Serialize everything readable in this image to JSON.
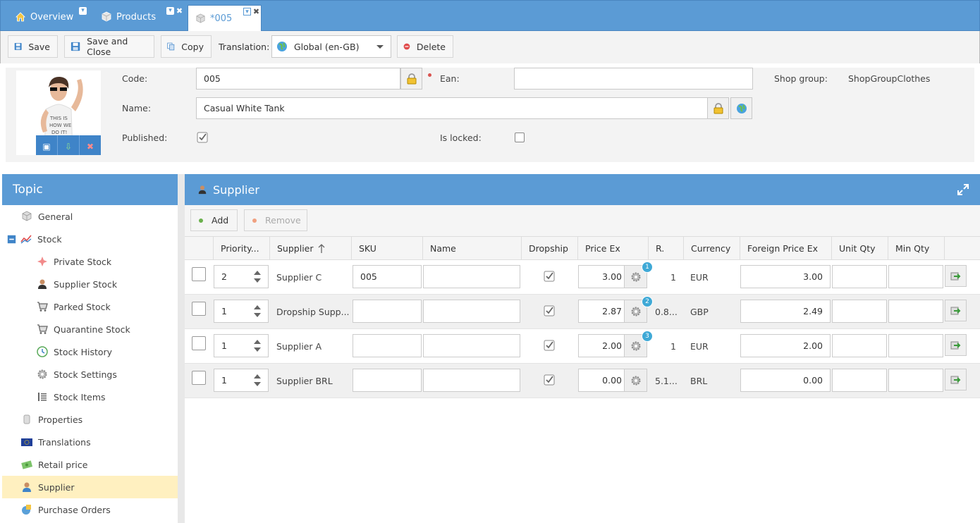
{
  "tabs": {
    "overview": "Overview",
    "products": "Products",
    "active": "*005"
  },
  "toolbar": {
    "save": "Save",
    "save_close": "Save and Close",
    "copy": "Copy",
    "translation_label": "Translation:",
    "translation_value": "Global (en-GB)",
    "delete": "Delete"
  },
  "form": {
    "code_label": "Code:",
    "code_value": "005",
    "ean_label": "Ean:",
    "ean_value": "",
    "shop_group_label": "Shop group:",
    "shop_group_value": "ShopGroupClothes",
    "name_label": "Name:",
    "name_value": "Casual White Tank",
    "published_label": "Published:",
    "published": true,
    "locked_label": "Is locked:",
    "locked": false
  },
  "topic": {
    "title": "Topic",
    "items": [
      {
        "label": "General",
        "level": 0
      },
      {
        "label": "Stock",
        "level": 0
      },
      {
        "label": "Private Stock",
        "level": 1
      },
      {
        "label": "Supplier Stock",
        "level": 1
      },
      {
        "label": "Parked Stock",
        "level": 1
      },
      {
        "label": "Quarantine Stock",
        "level": 1
      },
      {
        "label": "Stock History",
        "level": 1
      },
      {
        "label": "Stock Settings",
        "level": 1
      },
      {
        "label": "Stock Items",
        "level": 1
      },
      {
        "label": "Properties",
        "level": 0
      },
      {
        "label": "Translations",
        "level": 0
      },
      {
        "label": "Retail price",
        "level": 0
      },
      {
        "label": "Supplier",
        "level": 0,
        "selected": true
      },
      {
        "label": "Purchase Orders",
        "level": 0
      }
    ]
  },
  "supplier": {
    "title": "Supplier",
    "add": "Add",
    "remove": "Remove",
    "columns": [
      "Priority...",
      "Supplier",
      "SKU",
      "Name",
      "Dropship",
      "Price Ex",
      "R.",
      "Currency",
      "Foreign Price Ex",
      "Unit Qty",
      "Min Qty"
    ],
    "rows": [
      {
        "priority": "2",
        "supplier": "Supplier C",
        "sku": "005",
        "name": "",
        "dropship": true,
        "price": "3.00",
        "badge": "1",
        "rate": "1",
        "currency": "EUR",
        "foreign": "3.00"
      },
      {
        "priority": "1",
        "supplier": "Dropship Supp...",
        "sku": "",
        "name": "",
        "dropship": true,
        "price": "2.87",
        "badge": "2",
        "rate": "0.8...",
        "currency": "GBP",
        "foreign": "2.49"
      },
      {
        "priority": "1",
        "supplier": "Supplier A",
        "sku": "",
        "name": "",
        "dropship": true,
        "price": "2.00",
        "badge": "3",
        "rate": "1",
        "currency": "EUR",
        "foreign": "2.00"
      },
      {
        "priority": "1",
        "supplier": "Supplier BRL",
        "sku": "",
        "name": "",
        "dropship": true,
        "price": "0.00",
        "badge": "",
        "rate": "5.1...",
        "currency": "BRL",
        "foreign": "0.00"
      }
    ]
  }
}
